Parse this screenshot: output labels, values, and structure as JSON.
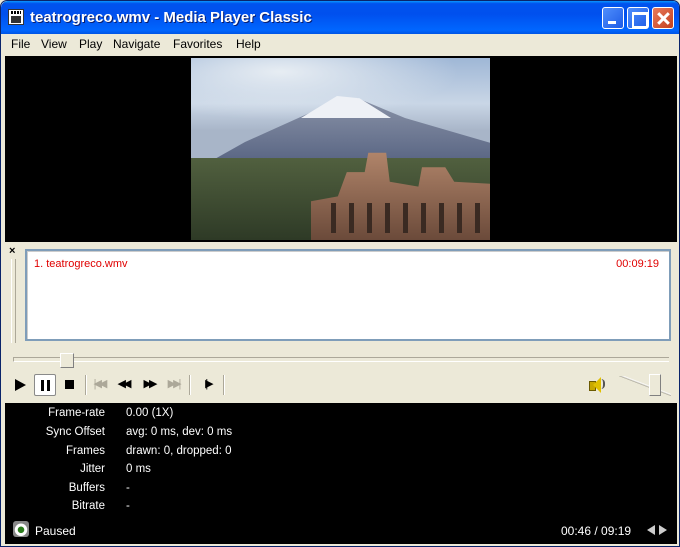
{
  "window": {
    "title": "teatrogreco.wmv - Media Player Classic"
  },
  "menu": [
    "File",
    "View",
    "Play",
    "Navigate",
    "Favorites",
    "Help"
  ],
  "playlist": {
    "items": [
      {
        "name": "1. teatrogreco.wmv",
        "duration": "00:09:19"
      }
    ]
  },
  "seek": {
    "position_fraction": 0.083
  },
  "volume": {
    "level_fraction": 0.7
  },
  "stats": [
    {
      "label": "Frame-rate",
      "value": "0.00 (1X)"
    },
    {
      "label": "Sync Offset",
      "value": "avg: 0 ms, dev: 0 ms"
    },
    {
      "label": "Frames",
      "value": "drawn: 0, dropped: 0"
    },
    {
      "label": "Jitter",
      "value": "0 ms"
    },
    {
      "label": "Buffers",
      "value": "-"
    },
    {
      "label": "Bitrate",
      "value": "-"
    }
  ],
  "status": {
    "text": "Paused",
    "time": "00:46 / 09:19"
  },
  "icons": {
    "app": "media-player-icon",
    "play": "play-icon",
    "pause": "pause-icon",
    "stop": "stop-icon",
    "prev": "skip-previous-icon",
    "rewind": "rewind-icon",
    "forward": "fast-forward-icon",
    "next": "skip-next-icon",
    "frame_step": "frame-step-icon",
    "volume": "speaker-icon"
  },
  "colors": {
    "playlist_text": "#e00000",
    "title_bar": "#0054e3"
  }
}
